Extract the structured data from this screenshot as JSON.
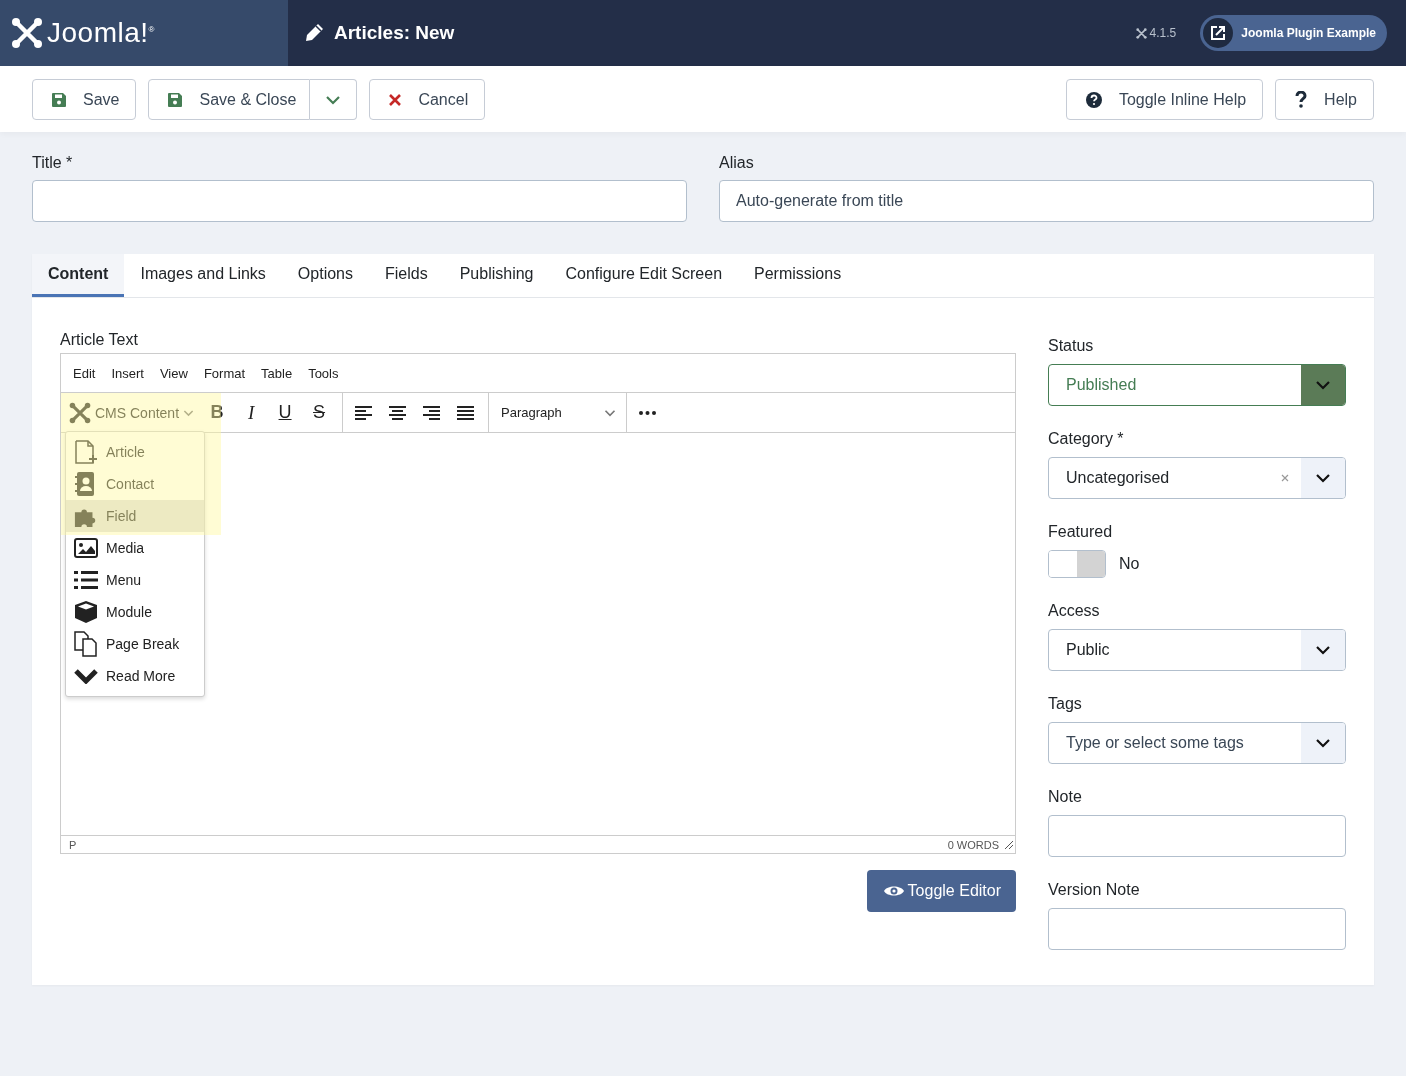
{
  "header": {
    "brand": "Joomla!$^{®}$",
    "page_title": "Articles: New",
    "version": "4.1.5",
    "site_link": "Joomla Plugin Example"
  },
  "toolbar": {
    "left": [
      {
        "kind": "save",
        "label": "Save"
      },
      {
        "kind": "save-split",
        "label": "Save & Close"
      },
      {
        "kind": "cancel",
        "label": "Cancel"
      }
    ],
    "right": [
      {
        "kind": "help-circle",
        "label": "Toggle Inline Help"
      },
      {
        "kind": "help",
        "label": "Help"
      }
    ]
  },
  "title_field": {
    "label": "Title *"
  },
  "alias_field": {
    "label": "Alias",
    "placeholder": "Auto-generate from title"
  },
  "tabs": [
    {
      "label": "Content",
      "selected": true
    },
    {
      "label": "Images and Links",
      "selected": false
    },
    {
      "label": "Options",
      "selected": false
    },
    {
      "label": "Fields",
      "selected": false
    },
    {
      "label": "Publishing",
      "selected": false
    },
    {
      "label": "Configure Edit Screen",
      "selected": false
    },
    {
      "label": "Permissions",
      "selected": false
    }
  ],
  "editor": {
    "label": "Article Text",
    "menu": [
      "Edit",
      "Insert",
      "View",
      "Format",
      "Table",
      "Tools"
    ],
    "cms_button": "CMS Content",
    "format_buttons": [
      {
        "kind": "bold",
        "glyph": "B"
      },
      {
        "kind": "italic",
        "glyph": "I"
      },
      {
        "kind": "underline",
        "glyph": "U"
      },
      {
        "kind": "strike",
        "glyph": "S"
      }
    ],
    "block_format": "Paragraph",
    "cms_menu": [
      {
        "label": "Article",
        "selected": false
      },
      {
        "label": "Contact",
        "selected": false
      },
      {
        "label": "Field",
        "selected": true
      },
      {
        "label": "Media",
        "selected": false
      },
      {
        "label": "Menu",
        "selected": false
      },
      {
        "label": "Module",
        "selected": false
      },
      {
        "label": "Page Break",
        "selected": false
      },
      {
        "label": "Read More",
        "selected": false
      }
    ],
    "path": "P",
    "word_count": "0 WORDS",
    "toggle_button": "Toggle Editor"
  },
  "sidebar": [
    {
      "kind": "status-select",
      "label": "Status",
      "value": "Published"
    },
    {
      "kind": "select",
      "label": "Category *",
      "value": "Uncategorised",
      "clearable": true
    },
    {
      "kind": "toggle",
      "label": "Featured",
      "on": false,
      "value": "No"
    },
    {
      "kind": "select",
      "label": "Access",
      "value": "Public",
      "clearable": false
    },
    {
      "kind": "select",
      "label": "Tags",
      "placeholder": "Type or select some tags",
      "clearable": false
    },
    {
      "kind": "input",
      "label": "Note"
    },
    {
      "kind": "input",
      "label": "Version Note"
    }
  ]
}
